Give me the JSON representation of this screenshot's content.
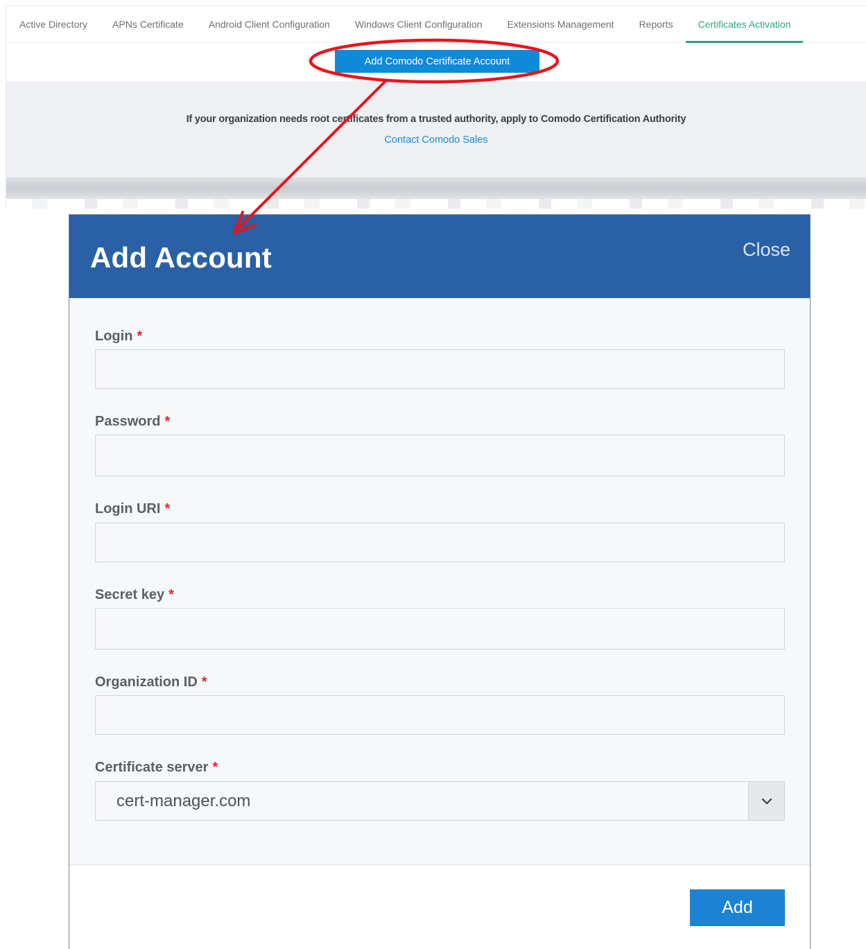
{
  "tabs": [
    {
      "label": "Active Directory",
      "active": false
    },
    {
      "label": "APNs Certificate",
      "active": false
    },
    {
      "label": "Android Client Configuration",
      "active": false
    },
    {
      "label": "Windows Client Configuration",
      "active": false
    },
    {
      "label": "Extensions Management",
      "active": false
    },
    {
      "label": "Reports",
      "active": false
    },
    {
      "label": "Certificates Activation",
      "active": true
    }
  ],
  "toolbar": {
    "add_certificate_account_label": "Add Comodo Certificate Account"
  },
  "info": {
    "text": "If your organization needs root certificates from a trusted authority, apply to Comodo Certification Authority",
    "link": "Contact Comodo Sales"
  },
  "dialog": {
    "title": "Add Account",
    "close_label": "Close",
    "fields": {
      "login": {
        "label": "Login",
        "required": "*",
        "value": ""
      },
      "password": {
        "label": "Password",
        "required": "*",
        "value": ""
      },
      "login_uri": {
        "label": "Login URI",
        "required": "*",
        "value": ""
      },
      "secret_key": {
        "label": "Secret key",
        "required": "*",
        "value": ""
      },
      "organization_id": {
        "label": "Organization ID",
        "required": "*",
        "value": ""
      },
      "certificate_server": {
        "label": "Certificate server",
        "required": "*",
        "value": "cert-manager.com"
      }
    },
    "add_label": "Add"
  },
  "colors": {
    "accent_green": "#2aa585",
    "header_blue": "#2960a6",
    "button_blue": "#1b83d2",
    "annotation_red": "#e8141c"
  },
  "icons": {
    "select_arrow": "chevron-down-icon"
  }
}
